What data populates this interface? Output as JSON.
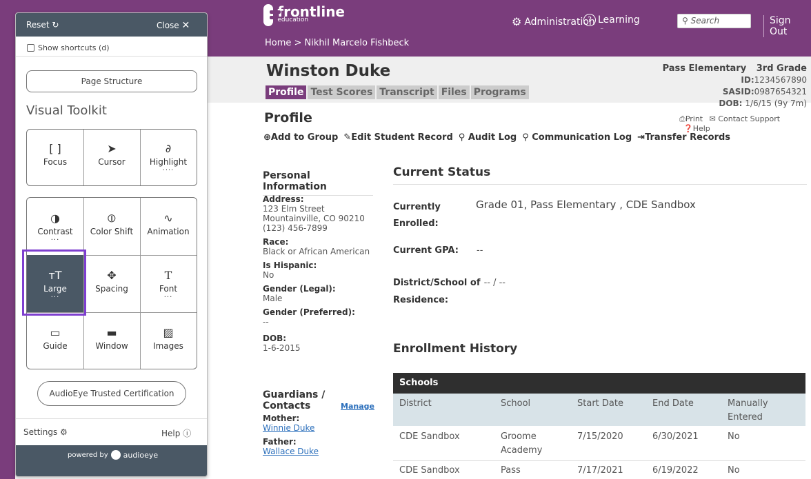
{
  "header": {
    "logo_name": "frontline",
    "logo_sub": "education",
    "breadcrumb": "Home > Nikhil Marcelo Fishbeck",
    "admin_label": "Administration",
    "learning_label": "Learning Center",
    "search_placeholder": "Search",
    "signout_label": "Sign Out"
  },
  "student": {
    "name": "Winston Duke",
    "school": "Pass Elementary",
    "grade": "3rd Grade",
    "id_label": "ID:",
    "id_value": "1234567890",
    "sasid_label": "SASID:",
    "sasid_value": "0987654321",
    "dob_label": "DOB:",
    "dob_value": "1/6/15 (9y 7m)"
  },
  "tabs": [
    {
      "label": "Profile"
    },
    {
      "label": "Test Scores"
    },
    {
      "label": "Transcript"
    },
    {
      "label": "Files"
    },
    {
      "label": "Programs"
    }
  ],
  "profile": {
    "title": "Profile",
    "print_label": "Print",
    "contact_label": "Contact Support",
    "help_label": "Help",
    "actions": [
      "Add to Group",
      "Edit Student Record",
      "Audit Log",
      "Communication Log",
      "Transfer Records"
    ]
  },
  "personal": {
    "heading": "Personal Information",
    "address_label": "Address:",
    "address_line1": "123 Elm Street",
    "address_line2": "Mountainville, CO 90210",
    "phone": "(123) 456-7899",
    "race_label": "Race:",
    "race_value": "Black or African American",
    "hispanic_label": "Is Hispanic:",
    "hispanic_value": "No",
    "gender_legal_label": "Gender (Legal):",
    "gender_legal_value": "Male",
    "gender_pref_label": "Gender (Preferred):",
    "gender_pref_value": "--",
    "dob_label": "DOB:",
    "dob_value": "1-6-2015"
  },
  "guardians": {
    "heading": "Guardians / Contacts",
    "manage_label": "Manage",
    "mother_label": "Mother:",
    "mother_name": "Winnie Duke",
    "father_label": "Father:",
    "father_name": "Wallace Duke"
  },
  "status": {
    "heading": "Current Status",
    "enrolled_label_1": "Currently",
    "enrolled_label_2": "Enrolled:",
    "enrolled_value": "Grade 01, Pass Elementary , CDE Sandbox",
    "gpa_label": "Current GPA:",
    "gpa_value": "--",
    "district_label_1": "District/School of",
    "district_value": "-- / --",
    "district_label_2": "Residence:"
  },
  "enrollment": {
    "heading": "Enrollment History",
    "table_title": "Schools",
    "columns": [
      "District",
      "School",
      "Start Date",
      "End Date",
      "Manually Entered"
    ],
    "rows": [
      [
        "CDE Sandbox",
        "Groome Academy",
        "7/15/2020",
        "6/30/2021",
        "No"
      ],
      [
        "CDE Sandbox",
        "Pass",
        "7/17/2021",
        "6/19/2022",
        "No"
      ]
    ]
  },
  "toolbox": {
    "reset_label": "Reset",
    "close_label": "Close",
    "shortcuts_label": "Show shortcuts (d)",
    "page_structure_label": "Page Structure",
    "visual_toolkit_label": "Visual Toolkit",
    "group1": [
      {
        "label": "Focus",
        "icon": "[ ]"
      },
      {
        "label": "Cursor",
        "icon": "➤"
      },
      {
        "label": "Highlight",
        "icon": "∂",
        "dots": "...."
      }
    ],
    "group2": [
      {
        "label": "Contrast",
        "icon": "◑",
        "dots": "..."
      },
      {
        "label": "Color Shift",
        "icon": "⦶"
      },
      {
        "label": "Animation",
        "icon": "∿"
      },
      {
        "label": "Large",
        "icon": "ᴛT",
        "dots": "..."
      },
      {
        "label": "Spacing",
        "icon": "✥"
      },
      {
        "label": "Font",
        "icon": "T",
        "dots": "..."
      },
      {
        "label": "Guide",
        "icon": "▭"
      },
      {
        "label": "Window",
        "icon": "▬"
      },
      {
        "label": "Images",
        "icon": "▨"
      }
    ],
    "certification_label": "AudioEye Trusted Certification",
    "settings_label": "Settings",
    "help_label": "Help",
    "powered_label": "powered by",
    "brand_label": "audioeye"
  },
  "colors": {
    "header_purple": "#7a3d7c",
    "toolbox_bar": "#4a5865",
    "selected_outline": "#7e3fcf",
    "table_head": "#2f2f2f"
  }
}
